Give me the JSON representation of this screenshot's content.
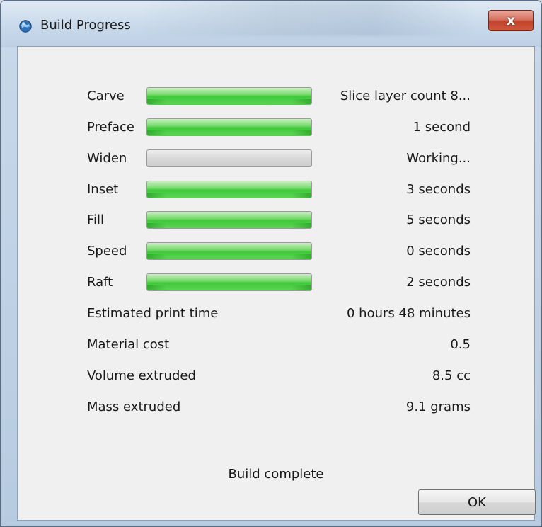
{
  "window": {
    "title": "Build Progress",
    "close_label": "x"
  },
  "steps": [
    {
      "label": "Carve",
      "value": "Slice layer count 8...",
      "progress": 1.0
    },
    {
      "label": "Preface",
      "value": "1 second",
      "progress": 1.0
    },
    {
      "label": "Widen",
      "value": "Working...",
      "progress": 0.0
    },
    {
      "label": "Inset",
      "value": "3 seconds",
      "progress": 1.0
    },
    {
      "label": "Fill",
      "value": "5 seconds",
      "progress": 1.0
    },
    {
      "label": "Speed",
      "value": "0 seconds",
      "progress": 1.0
    },
    {
      "label": "Raft",
      "value": "2 seconds",
      "progress": 1.0
    }
  ],
  "stats": [
    {
      "label": "Estimated print time",
      "value": "0 hours 48 minutes"
    },
    {
      "label": "Material cost",
      "value": "0.5"
    },
    {
      "label": "Volume extruded",
      "value": "8.5 cc"
    },
    {
      "label": "Mass extruded",
      "value": "9.1 grams"
    }
  ],
  "status_text": "Build complete",
  "ok_label": "OK",
  "colors": {
    "progress_fill": "#3fc93a",
    "progress_track": "#d9d9d9",
    "close_button": "#c1432b"
  },
  "icons": {
    "app": "globe-icon"
  }
}
